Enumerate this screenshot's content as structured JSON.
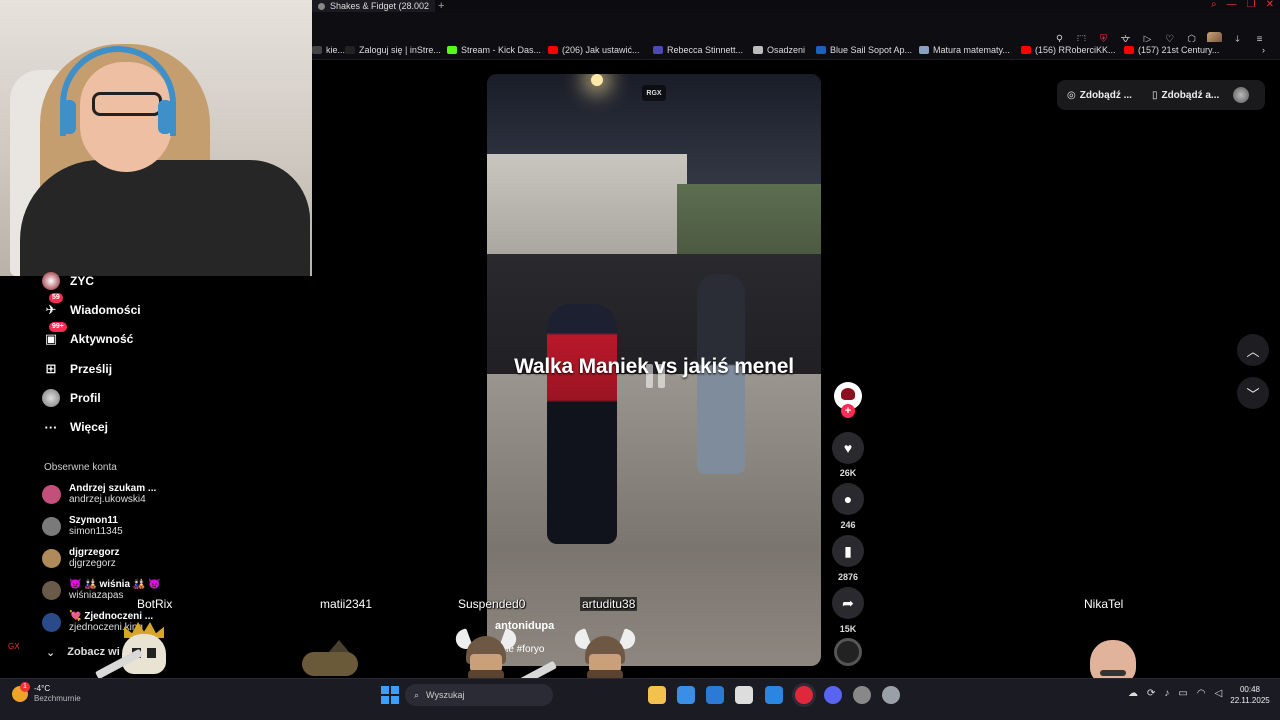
{
  "browser": {
    "tab_title": "Shakes & Fidget (28.002",
    "new_tab_glyph": "+",
    "window_controls": [
      "⌕",
      "—",
      "❐",
      "✕"
    ],
    "toolbar_icons": [
      "pin-icon",
      "screenshot-icon",
      "shield-icon",
      "translate-icon",
      "play-icon",
      "heart-icon",
      "extensions-icon",
      "profile-icon",
      "download-icon",
      "menu-icon"
    ],
    "bookmarks": [
      {
        "label": "kie...",
        "icon": "blank",
        "color": "#444444"
      },
      {
        "label": "Zaloguj się | inStre...",
        "icon": "blank",
        "color": "#222222"
      },
      {
        "label": "Stream - Kick Das...",
        "icon": "kick-icon",
        "color": "#53fc18"
      },
      {
        "label": "(206) Jak ustawić...",
        "icon": "youtube-icon",
        "color": "#ff0000"
      },
      {
        "label": "Rebecca Stinnett...",
        "icon": "site-icon",
        "color": "#4a4ab0"
      },
      {
        "label": "Osadzeni",
        "icon": "site-icon",
        "color": "#bbbbbb"
      },
      {
        "label": "Blue Sail Sopot Ap...",
        "icon": "booking-icon",
        "color": "#1e5fbf"
      },
      {
        "label": "Matura matematy...",
        "icon": "doc-icon",
        "color": "#8aa0c0"
      },
      {
        "label": "(156) RRoberciKK...",
        "icon": "youtube-icon",
        "color": "#ff0000"
      },
      {
        "label": "(157) 21st Century...",
        "icon": "youtube-icon",
        "color": "#ff0000"
      }
    ],
    "bookmarks_more": "›"
  },
  "sidebar": {
    "items": [
      {
        "label": "ZYC",
        "icon": "avatar-icon",
        "badge": ""
      },
      {
        "label": "Wiadomości",
        "icon": "messages-icon",
        "badge": "59"
      },
      {
        "label": "Aktywność",
        "icon": "activity-icon",
        "badge": "99+"
      },
      {
        "label": "Prześlij",
        "icon": "upload-icon",
        "badge": ""
      },
      {
        "label": "Profil",
        "icon": "profile-icon",
        "badge": ""
      },
      {
        "label": "Więcej",
        "icon": "more-icon",
        "badge": ""
      }
    ],
    "following_title": "Obserwne konta",
    "following": [
      {
        "name": "Andrzej szukam ...",
        "user": "andrzej.ukowski4",
        "color": "#c2507a"
      },
      {
        "name": "Szymon11",
        "user": "simon11345",
        "color": "#7a7a7a"
      },
      {
        "name": "djgrzegorz",
        "user": "djgrzegorz",
        "color": "#b08a5a"
      },
      {
        "name": "👿 🎎 wiśnia 🎎 👿",
        "user": "wiśniazapas",
        "color": "#6a5a4a"
      },
      {
        "name": "💘 Zjednoczeni ...",
        "user": "zjednoczeni.king",
        "color": "#2a4a8a"
      }
    ],
    "see_more": "Zobacz wi"
  },
  "video": {
    "caption": "Walka Maniek vs jakiś menel",
    "watermark": "RGX",
    "author": "antonidupa",
    "description": "ebie #foryo"
  },
  "actions": {
    "follow_plus": "+",
    "like_count": "26K",
    "comment_count": "246",
    "save_count": "2876",
    "share_count": "15K"
  },
  "top_right": {
    "get_coins": "Zdobądź ...",
    "get_app": "Zdobądź a..."
  },
  "overlay": {
    "names": [
      "BotRix",
      "matii2341",
      "Suspended0",
      "artuditu38",
      "NikaTel"
    ]
  },
  "taskbar": {
    "temperature": "-4°C",
    "condition": "Bezchmurnie",
    "weather_badge": "1",
    "search_placeholder": "Wyszukaj",
    "time": "00:48",
    "date": "22.11.2025",
    "gx_label": "GX",
    "apps": [
      {
        "name": "file-explorer-icon",
        "color": "#f2c14e"
      },
      {
        "name": "store-icon",
        "color": "#3a8ee6"
      },
      {
        "name": "mail-icon",
        "color": "#2a7ad6"
      },
      {
        "name": "app-c-icon",
        "color": "#dddddd"
      },
      {
        "name": "app-blue-icon",
        "color": "#2a86e0"
      },
      {
        "name": "opera-gx-icon",
        "color": "#e0283c"
      },
      {
        "name": "discord-icon",
        "color": "#5865f2"
      },
      {
        "name": "app-round-icon",
        "color": "#888888"
      },
      {
        "name": "settings-icon",
        "color": "#9aa0a8"
      }
    ]
  }
}
